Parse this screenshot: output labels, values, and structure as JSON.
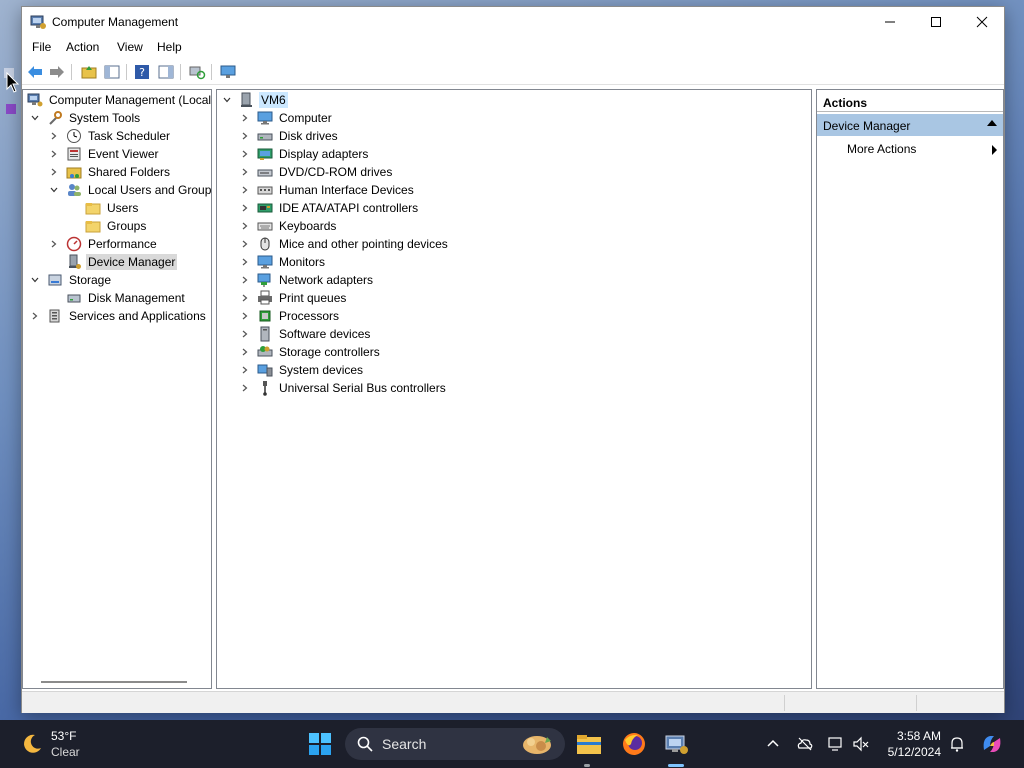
{
  "window": {
    "title": "Computer Management",
    "menu": [
      "File",
      "Action",
      "View",
      "Help"
    ]
  },
  "tree": {
    "items": [
      {
        "label": "Computer Management (Local",
        "icon": "computer-management-icon",
        "level": 0,
        "expander": "none",
        "state": ""
      },
      {
        "label": "System Tools",
        "icon": "system-tools-icon",
        "level": 1,
        "expander": "expanded",
        "state": ""
      },
      {
        "label": "Task Scheduler",
        "icon": "clock-icon",
        "level": 2,
        "expander": "collapsed",
        "state": ""
      },
      {
        "label": "Event Viewer",
        "icon": "event-viewer-icon",
        "level": 2,
        "expander": "collapsed",
        "state": ""
      },
      {
        "label": "Shared Folders",
        "icon": "shared-folder-icon",
        "level": 2,
        "expander": "collapsed",
        "state": ""
      },
      {
        "label": "Local Users and Groups",
        "icon": "users-icon",
        "level": 2,
        "expander": "expanded",
        "state": ""
      },
      {
        "label": "Users",
        "icon": "folder-icon",
        "level": 3,
        "expander": "none",
        "state": ""
      },
      {
        "label": "Groups",
        "icon": "folder-icon",
        "level": 3,
        "expander": "none",
        "state": ""
      },
      {
        "label": "Performance",
        "icon": "performance-icon",
        "level": 2,
        "expander": "collapsed",
        "state": ""
      },
      {
        "label": "Device Manager",
        "icon": "device-manager-icon",
        "level": 2,
        "expander": "none",
        "state": "selected"
      },
      {
        "label": "Storage",
        "icon": "storage-icon",
        "level": 1,
        "expander": "expanded",
        "state": ""
      },
      {
        "label": "Disk Management",
        "icon": "disk-management-icon",
        "level": 2,
        "expander": "none",
        "state": ""
      },
      {
        "label": "Services and Applications",
        "icon": "services-icon",
        "level": 1,
        "expander": "collapsed",
        "state": ""
      }
    ]
  },
  "devices": {
    "root": "VM6",
    "categories": [
      {
        "label": "Computer",
        "icon": "monitor-icon"
      },
      {
        "label": "Disk drives",
        "icon": "disk-drive-icon"
      },
      {
        "label": "Display adapters",
        "icon": "display-adapter-icon"
      },
      {
        "label": "DVD/CD-ROM drives",
        "icon": "dvd-drive-icon"
      },
      {
        "label": "Human Interface Devices",
        "icon": "hid-icon"
      },
      {
        "label": "IDE ATA/ATAPI controllers",
        "icon": "ide-controller-icon"
      },
      {
        "label": "Keyboards",
        "icon": "keyboard-icon"
      },
      {
        "label": "Mice and other pointing devices",
        "icon": "mouse-icon"
      },
      {
        "label": "Monitors",
        "icon": "monitor-icon"
      },
      {
        "label": "Network adapters",
        "icon": "network-adapter-icon"
      },
      {
        "label": "Print queues",
        "icon": "printer-icon"
      },
      {
        "label": "Processors",
        "icon": "processor-icon"
      },
      {
        "label": "Software devices",
        "icon": "software-device-icon"
      },
      {
        "label": "Storage controllers",
        "icon": "storage-controller-icon"
      },
      {
        "label": "System devices",
        "icon": "system-device-icon"
      },
      {
        "label": "Universal Serial Bus controllers",
        "icon": "usb-icon"
      }
    ]
  },
  "actions": {
    "header": "Actions",
    "section": "Device Manager",
    "more": "More Actions"
  },
  "taskbar": {
    "weather_temp": "53°F",
    "weather_cond": "Clear",
    "search_label": "Search",
    "time": "3:58 AM",
    "date": "5/12/2024"
  }
}
